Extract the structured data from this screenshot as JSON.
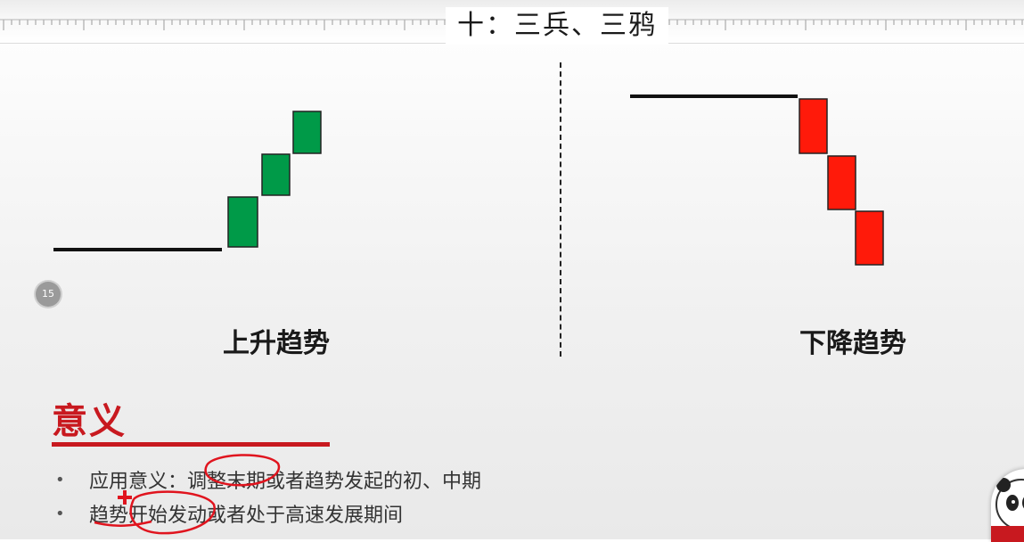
{
  "slide": {
    "title": "十：三兵、三鸦",
    "left_caption": "上升趋势",
    "right_caption": "下降趋势",
    "section_title": "意义",
    "bullets": [
      "应用意义：调整末期或者趋势发起的初、中期",
      "趋势开始发动或者处于高速发展期间"
    ],
    "bullet_symbol": "•"
  },
  "player": {
    "replay_label": "15"
  },
  "colors": {
    "up_candle": "#009a48",
    "down_candle": "#ff1a0a",
    "accent": "#c8191f",
    "annotation": "#e0141e"
  },
  "icons": {
    "replay": "replay-15-icon",
    "presenter": "panda-avatar-icon"
  }
}
